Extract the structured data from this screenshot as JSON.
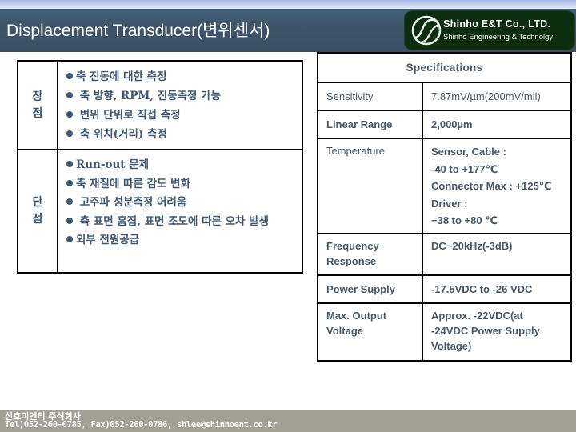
{
  "header": {
    "title": "Displacement Transducer(변위센서)",
    "logo": {
      "icon": "shinho-s-wave-logo-icon",
      "company_name": "Shinho E&T Co., LTD.",
      "company_subtitle": "Shinho Engineering & Technolgy",
      "background_color": "#0c2d0e"
    }
  },
  "pros_cons": {
    "pros": {
      "label": "장점",
      "items": [
        "축 진동에 대한 측정",
        " 축 방향, RPM, 진동측정 가능",
        " 변위 단위로 직접 측정",
        " 축 위치(거리) 측정"
      ]
    },
    "cons": {
      "label": "단점",
      "items": [
        "Run-out 문제",
        "축 재질에 따른 감도 변화",
        " 고주파 성분측정 어려움",
        " 축 표면 흠집, 표면 조도에 따른 오차 발생",
        "외부 전원공급"
      ]
    },
    "text_color": "#3e5874"
  },
  "specifications": {
    "title": "Specifications",
    "rows": [
      {
        "key": "Sensitivity",
        "value": [
          "7.87mV/µm(200mV/mil)"
        ]
      },
      {
        "key": "Linear Range",
        "value": [
          "2,000µm"
        ]
      },
      {
        "key": "Temperature",
        "value": [
          "Sensor, Cable :",
          "-40 to +177℃",
          "Connector Max : +125℃",
          "Driver :",
          "−38 to +80 ℃"
        ]
      },
      {
        "key": "Frequency Response",
        "value": [
          "DC~20kHz(-3dB)"
        ]
      },
      {
        "key": "Power Supply",
        "value": [
          "-17.5VDC to -26 VDC"
        ]
      },
      {
        "key": "Max. Output Voltage",
        "value": [
          "Approx. -22VDC(at -24VDC Power Supply Voltage)"
        ]
      }
    ]
  },
  "footer": {
    "company": "신호이엔티 주식회사",
    "contact": "Tel)052-260-0785, Fax)052-260-0786, shlee@shinhoent.co.kr",
    "background_color": "#a0a093"
  }
}
